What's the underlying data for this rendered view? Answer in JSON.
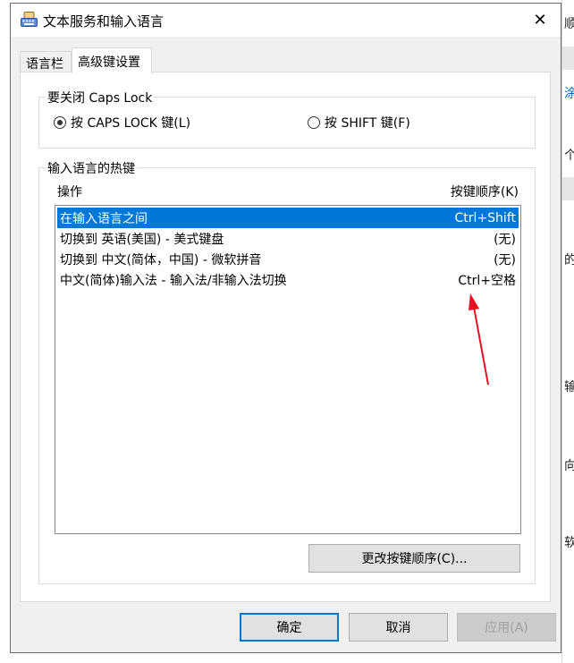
{
  "window": {
    "title": "文本服务和输入语言",
    "close_label": "✕"
  },
  "tabs": [
    {
      "label": "语言栏",
      "active": false
    },
    {
      "label": "高级键设置",
      "active": true
    }
  ],
  "caps_lock_group": {
    "title": "要关闭 Caps Lock",
    "options": [
      {
        "label": "按 CAPS LOCK 键(L)",
        "checked": true
      },
      {
        "label": "按 SHIFT 键(F)",
        "checked": false
      }
    ]
  },
  "hotkeys_group": {
    "title": "输入语言的热键",
    "col_action": "操作",
    "col_key": "按键顺序(K)",
    "rows": [
      {
        "action": "在输入语言之间",
        "key": "Ctrl+Shift",
        "selected": true
      },
      {
        "action": "切换到 英语(美国) - 美式键盘",
        "key": "(无)",
        "selected": false
      },
      {
        "action": "切换到 中文(简体，中国) - 微软拼音",
        "key": "(无)",
        "selected": false
      },
      {
        "action": "中文(简体)输入法 - 输入法/非输入法切换",
        "key": "Ctrl+空格",
        "selected": false
      }
    ],
    "change_button": "更改按键顺序(C)..."
  },
  "buttons": {
    "ok": "确定",
    "cancel": "取消",
    "apply": "应用(A)"
  },
  "background_fragments": [
    "顺",
    "涂",
    "个",
    "的",
    "输",
    "向",
    "软"
  ],
  "colors": {
    "selection": "#0078d7",
    "annotation_arrow": "#e81123",
    "link_blue": "#0067c0"
  },
  "icons": {
    "app": "keyboard-icon",
    "close": "close-icon",
    "annotation": "red-arrow-annotation"
  }
}
